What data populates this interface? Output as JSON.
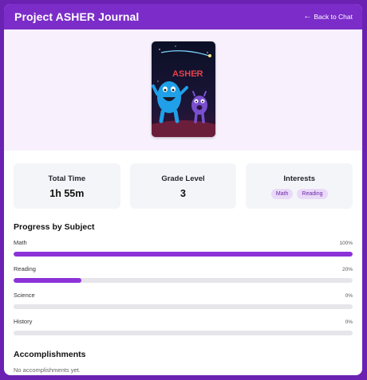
{
  "header": {
    "title": "Project ASHER Journal",
    "back_label": "Back to Chat"
  },
  "avatar": {
    "sign_text": "ASHER"
  },
  "stats": {
    "total_time": {
      "label": "Total Time",
      "value": "1h 55m"
    },
    "grade_level": {
      "label": "Grade Level",
      "value": "3"
    },
    "interests": {
      "label": "Interests",
      "tags": [
        "Math",
        "Reading"
      ]
    }
  },
  "progress": {
    "title": "Progress by Subject",
    "subjects": [
      {
        "name": "Math",
        "percent_label": "100%",
        "percent": 100
      },
      {
        "name": "Reading",
        "percent_label": "20%",
        "percent": 20
      },
      {
        "name": "Science",
        "percent_label": "0%",
        "percent": 0
      },
      {
        "name": "History",
        "percent_label": "0%",
        "percent": 0
      }
    ]
  },
  "accomplishments": {
    "title": "Accomplishments",
    "empty_text": "No accomplishments yet."
  },
  "colors": {
    "brand": "#7b2cc9",
    "progress_fill": "#8b32d8",
    "chip_bg": "#ead9f8"
  }
}
